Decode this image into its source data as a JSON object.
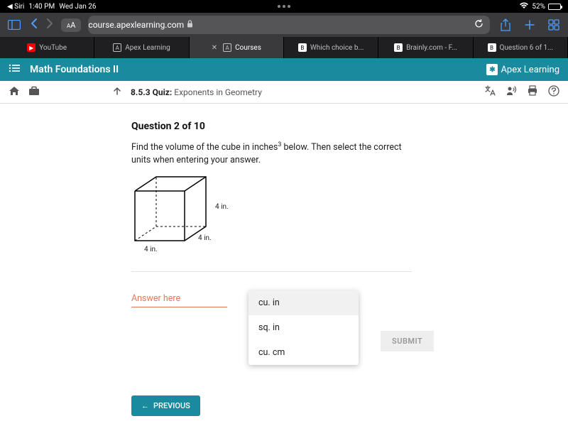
{
  "status": {
    "back_app": "◀ Siri",
    "time": "1:40 PM",
    "date": "Wed Jan 26",
    "wifi": "52%"
  },
  "safari": {
    "aa": "AA",
    "url": "course.apexlearning.com"
  },
  "browser_tabs": [
    {
      "label": "YouTube"
    },
    {
      "label": "Apex Learning"
    },
    {
      "label": "Courses"
    },
    {
      "label": "Which choice b..."
    },
    {
      "label": "Brainly.com - F..."
    },
    {
      "label": "Question 6 of 1..."
    }
  ],
  "app": {
    "title": "Math Foundations II",
    "brand": "Apex Learning"
  },
  "crumb": {
    "code": "8.5.3",
    "type": "Quiz:",
    "name": "Exponents in Geometry"
  },
  "question": {
    "title": "Question 2 of 10",
    "text_a": "Find the volume of the cube in inches",
    "sup": "3",
    "text_b": " below. Then select the correct units when entering your answer.",
    "dim": "4 in."
  },
  "answer": {
    "placeholder": "Answer here"
  },
  "units": [
    "cu. in",
    "sq. in",
    "cu. cm"
  ],
  "buttons": {
    "submit": "SUBMIT",
    "previous": "PREVIOUS"
  }
}
